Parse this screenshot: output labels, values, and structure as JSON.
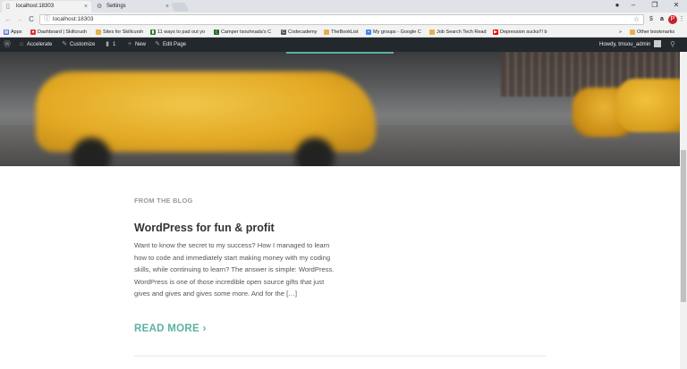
{
  "browser": {
    "tabs": [
      {
        "title": "localhost:18303",
        "icon": "page-icon",
        "active": true
      },
      {
        "title": "Settings",
        "icon": "gear-icon",
        "active": false
      }
    ],
    "close_glyph": "×",
    "window_controls": {
      "minimize": "–",
      "maximize": "❐",
      "close": "✕"
    },
    "nav": {
      "back": "←",
      "forward": "→",
      "reload": "C"
    },
    "address": {
      "info_glyph": "ⓘ",
      "url": "localhost:18303",
      "star_glyph": "☆"
    },
    "extensions": [
      {
        "name": "dollar-extension-icon",
        "glyph": "$",
        "color": "#444"
      },
      {
        "name": "amazon-extension-icon",
        "glyph": "a",
        "color": "#222"
      },
      {
        "name": "pinterest-extension-icon",
        "glyph": "P",
        "color": "#fff",
        "bg": "#cb2027"
      },
      {
        "name": "menu-icon",
        "glyph": "⋮",
        "color": "#444"
      }
    ]
  },
  "bookmarks": {
    "apps_label": "Apps",
    "items": [
      {
        "label": "Dashboard | Skillcrush",
        "icon_color": "#d33",
        "icon": "skillcrush-icon"
      },
      {
        "label": "Sites for Skillcursh",
        "icon_color": "#e8b04a",
        "icon": "folder-icon"
      },
      {
        "label": "11 ways to pad out yo",
        "icon_color": "#2a7d2a",
        "icon": "bookmark-icon"
      },
      {
        "label": "Camper tsouhnada's C",
        "icon_color": "#1f6b1f",
        "icon": "freecodecamp-icon"
      },
      {
        "label": "Codecademy",
        "icon_color": "#555",
        "icon": "codecademy-icon"
      },
      {
        "label": "TheBookList",
        "icon_color": "#e8b04a",
        "icon": "folder-icon"
      },
      {
        "label": "My groups - Google C",
        "icon_color": "#4285f4",
        "icon": "google-groups-icon"
      },
      {
        "label": "Job Search Tech Read",
        "icon_color": "#e8b04a",
        "icon": "folder-icon"
      },
      {
        "label": "Depression sucks!!! b",
        "icon_color": "#e00",
        "icon": "youtube-icon"
      }
    ],
    "overflow": "»",
    "other_bookmarks": "Other bookmarks"
  },
  "adminbar": {
    "wp_glyph": "Ⓦ",
    "site_name": "Accelerate",
    "site_glyph": "⌂",
    "customize": "Customize",
    "customize_glyph": "✎",
    "comments_count": "1",
    "comments_glyph": "▮",
    "new_label": "New",
    "new_glyph": "+",
    "edit_page": "Edit Page",
    "edit_glyph": "✎",
    "howdy": "Howdy, tmsou_admin",
    "search_glyph": "⚲"
  },
  "blog": {
    "section_label": "FROM THE BLOG",
    "post_title": "WordPress for fun & profit",
    "excerpt": "Want to know the secret to my success? How I managed to learn how to code and immediately start making money with my coding skills, while continuing to learn? The answer is simple: WordPress. WordPress is one of those incredible open source gifts that just gives and gives and gives some more. And for the […]",
    "read_more": "READ MORE ›",
    "cutoff_left": "",
    "cutoff_right": ""
  },
  "colors": {
    "accent": "#5bb1a2",
    "admin_bar": "#23282d"
  }
}
